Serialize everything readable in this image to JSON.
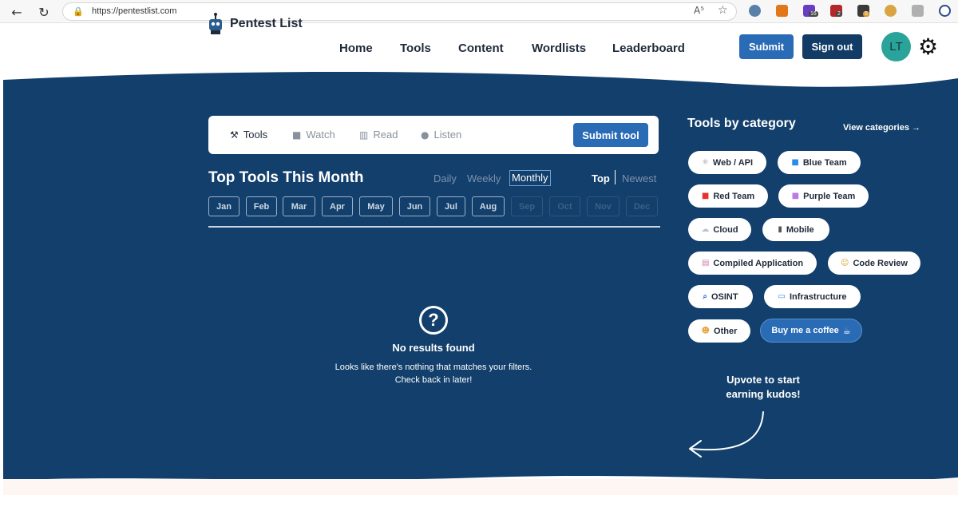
{
  "browser": {
    "url": "https://pentestlist.com",
    "reader_label": "A⁵",
    "ext_badges": [
      "16",
      "2",
      "5"
    ]
  },
  "header": {
    "brand": "Pentest List",
    "nav": [
      "Home",
      "Tools",
      "Content",
      "Wordlists",
      "Leaderboard"
    ],
    "submit_label": "Submit",
    "signout_label": "Sign out",
    "avatar_initials": "LT"
  },
  "tabs": {
    "items": [
      {
        "label": "Tools",
        "icon": "tools-icon",
        "glyph": "⚒"
      },
      {
        "label": "Watch",
        "icon": "video-icon",
        "glyph": "■"
      },
      {
        "label": "Read",
        "icon": "book-icon",
        "glyph": "▥"
      },
      {
        "label": "Listen",
        "icon": "microphone-icon",
        "glyph": "●"
      }
    ],
    "submit_tool_label": "Submit tool"
  },
  "listing": {
    "title": "Top Tools This Month",
    "periods": [
      "Daily",
      "Weekly",
      "Monthly"
    ],
    "selected_period": "Monthly",
    "sort": [
      "Top",
      "Newest"
    ],
    "selected_sort": "Top",
    "months": [
      "Jan",
      "Feb",
      "Mar",
      "Apr",
      "May",
      "Jun",
      "Jul",
      "Aug",
      "Sep",
      "Oct",
      "Nov",
      "Dec"
    ],
    "disabled_months": [
      "Sep",
      "Oct",
      "Nov",
      "Dec"
    ]
  },
  "empty_state": {
    "icon_glyph": "?",
    "title": "No results found",
    "line1": "Looks like there's nothing that matches your filters.",
    "line2": "Check back in later!"
  },
  "sidebar": {
    "title": "Tools by category",
    "view_all": "View categories →",
    "categories": [
      {
        "label": "Web / API",
        "icon": "atom-icon",
        "glyph": "⚛",
        "color": "#8a8fa0"
      },
      {
        "label": "Blue Team",
        "icon": "blue-square-icon",
        "glyph": "■",
        "color": "#2b8ce6"
      },
      {
        "label": "Red Team",
        "icon": "red-square-icon",
        "glyph": "■",
        "color": "#e5322d"
      },
      {
        "label": "Purple Team",
        "icon": "purple-square-icon",
        "glyph": "■",
        "color": "#b77be6"
      },
      {
        "label": "Cloud",
        "icon": "cloud-icon",
        "glyph": "☁",
        "color": "#b9c3cf"
      },
      {
        "label": "Mobile",
        "icon": "mobile-icon",
        "glyph": "▮",
        "color": "#555555"
      },
      {
        "label": "Compiled Application",
        "icon": "document-icon",
        "glyph": "▤",
        "color": "#d47bb0"
      },
      {
        "label": "Code Review",
        "icon": "person-icon",
        "glyph": "☺",
        "color": "#d8a02b"
      },
      {
        "label": "OSINT",
        "icon": "magnifier-icon",
        "glyph": "⌕",
        "color": "#2b6fd6"
      },
      {
        "label": "Infrastructure",
        "icon": "monitor-icon",
        "glyph": "▭",
        "color": "#2b8ce6"
      },
      {
        "label": "Other",
        "icon": "emoji-icon",
        "glyph": "☻",
        "color": "#e8a23b"
      }
    ],
    "coffee_label": "Buy me a coffee",
    "coffee_glyph": "☕",
    "upvote_line1": "Upvote to start",
    "upvote_line2": "earning kudos!"
  },
  "colors": {
    "hero_bg": "#123f6b",
    "primary_button": "#2a6bb5",
    "dark_button": "#123b66",
    "avatar": "#2aa39a"
  }
}
